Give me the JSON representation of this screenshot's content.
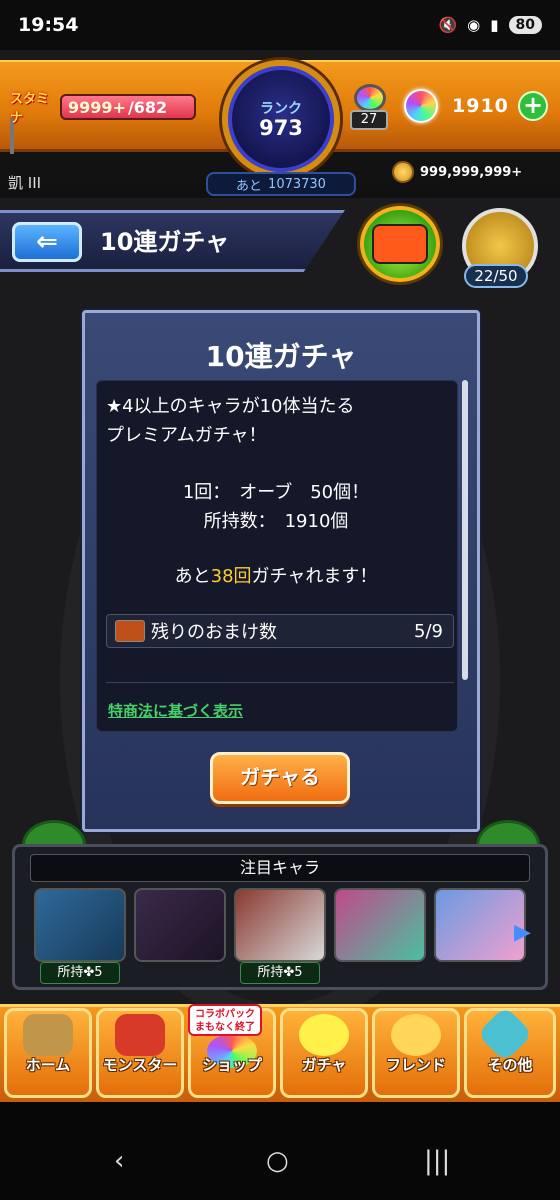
{
  "status_bar": {
    "time": "19:54",
    "battery": "80"
  },
  "header": {
    "stamina_label": "スタミナ",
    "stamina_current": "9999+",
    "stamina_max": "/682",
    "rank_label": "ランク",
    "rank_value": "973",
    "rank_next_label": "あと",
    "rank_next_value": "1073730",
    "lab_level": "27",
    "orb_count": "1910",
    "coins": "999,999,999+",
    "player_name": "凱 III"
  },
  "title_bar": {
    "title": "10連ガチャ",
    "mission_count": "22/50"
  },
  "dialog": {
    "title": "10連ガチャ",
    "desc_line1": "★4以上のキャラが10体当たる",
    "desc_line2": "プレミアムガチャ！",
    "cost_line1": "1回：　オーブ　50個！",
    "cost_line2": "所持数：　1910個",
    "remain_prefix": "あと",
    "remain_count": "38回",
    "remain_suffix": "ガチャれます！",
    "bonus_label": "残りのおまけ数",
    "bonus_value": "5/9",
    "legal_link": "特商法に基づく表示",
    "gacha_button": "ガチャる"
  },
  "featured": {
    "title": "注目キャラ",
    "characters": [
      {
        "tag": "所持✤5",
        "color": "#2f6a9a"
      },
      {
        "tag": "",
        "color": "#3a2a4a"
      },
      {
        "tag": "所持✤5",
        "color": "#8a3a30"
      },
      {
        "tag": "",
        "color": "#c04a8a"
      },
      {
        "tag": "",
        "color": "#6a9ae0"
      }
    ]
  },
  "bottom_nav": {
    "shop_badge": "コラボパック まもなく終了",
    "items": [
      "ホーム",
      "モンスター",
      "ショップ",
      "ガチャ",
      "フレンド",
      "その他"
    ]
  },
  "colors": {
    "accent_orange": "#f08a14",
    "dialog_blue": "#2f3b66",
    "link_green": "#46d06a",
    "highlight_yellow": "#ffcc33"
  }
}
